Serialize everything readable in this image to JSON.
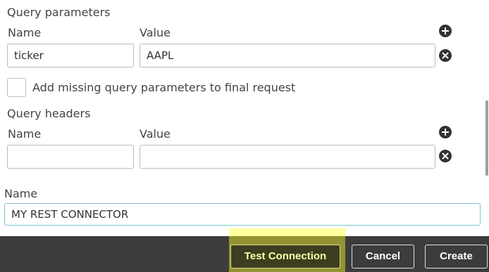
{
  "query_parameters": {
    "title": "Query parameters",
    "name_label": "Name",
    "value_label": "Value",
    "rows": [
      {
        "name": "ticker",
        "value": "AAPL"
      }
    ],
    "add_icon": "plus-circle-icon",
    "remove_icon": "x-circle-icon"
  },
  "add_missing": {
    "label": "Add missing query parameters to final request",
    "checked": false
  },
  "query_headers": {
    "title": "Query headers",
    "name_label": "Name",
    "value_label": "Value",
    "rows": [
      {
        "name": "",
        "value": ""
      }
    ],
    "add_icon": "plus-circle-icon",
    "remove_icon": "x-circle-icon"
  },
  "connection_name": {
    "label": "Name",
    "value": "MY REST CONNECTOR"
  },
  "footer": {
    "test_connection_label": "Test Connection",
    "cancel_label": "Cancel",
    "create_label": "Create"
  },
  "colors": {
    "footer_bg": "#3c3c3c",
    "highlight": "#ffff28",
    "focus_border": "#7ec3cf",
    "icon": "#333333"
  }
}
